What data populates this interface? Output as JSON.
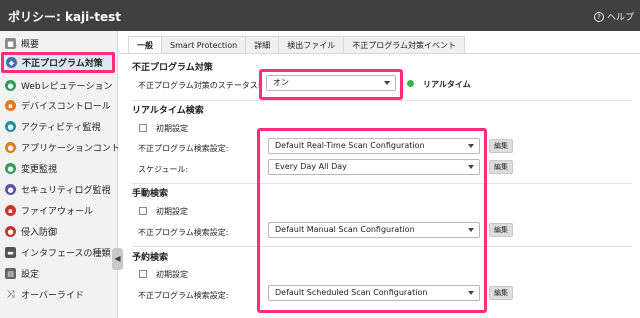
{
  "window": {
    "title": "ポリシー: kaji-test",
    "help_label": "ヘルプ"
  },
  "sidebar": {
    "items": [
      {
        "label": "概要",
        "icon": "overview-icon",
        "color": "#8a8a8a"
      },
      {
        "label": "不正プログラム対策",
        "icon": "shield-icon",
        "color": "#3f6fb6",
        "active": true
      },
      {
        "label": "Webレピュテーション",
        "icon": "globe-icon",
        "color": "#2f9e5a"
      },
      {
        "label": "デバイスコントロール",
        "icon": "device-icon",
        "color": "#e07a1f"
      },
      {
        "label": "アクティビティ監視",
        "icon": "activity-icon",
        "color": "#1f8fa8"
      },
      {
        "label": "アプリケーションコント",
        "icon": "app-control-icon",
        "color": "#e07a1f"
      },
      {
        "label": "変更監視",
        "icon": "integrity-icon",
        "color": "#2f9e5a"
      },
      {
        "label": "セキュリティログ監視",
        "icon": "log-inspection-icon",
        "color": "#5a4fb0"
      },
      {
        "label": "ファイアウォール",
        "icon": "firewall-icon",
        "color": "#c0392b"
      },
      {
        "label": "侵入防御",
        "icon": "intrusion-icon",
        "color": "#c0392b"
      },
      {
        "label": "インタフェースの種類",
        "icon": "interface-icon",
        "color": "#555555"
      },
      {
        "label": "設定",
        "icon": "settings-icon",
        "color": "#666666"
      },
      {
        "label": "オーバーライド",
        "icon": "override-icon",
        "color": "#444444"
      }
    ]
  },
  "tabs": [
    "一般",
    "Smart Protection",
    "詳細",
    "検出ファイル",
    "不正プログラム対策イベント"
  ],
  "general": {
    "heading": "不正プログラム対策",
    "status_label": "不正プログラム対策のステータス:",
    "status_value": "オン",
    "status_mode": "リアルタイム"
  },
  "realtime": {
    "heading": "リアルタイム検索",
    "inherit_label": "初期設定",
    "config_label": "不正プログラム検索設定:",
    "config_value": "Default Real-Time Scan Configuration",
    "schedule_label": "スケジュール:",
    "schedule_value": "Every Day All Day"
  },
  "manual": {
    "heading": "手動検索",
    "inherit_label": "初期設定",
    "config_label": "不正プログラム検索設定:",
    "config_value": "Default Manual Scan Configuration"
  },
  "scheduled": {
    "heading": "予約検索",
    "inherit_label": "初期設定",
    "config_label": "不正プログラム検索設定:",
    "config_value": "Default Scheduled Scan Configuration"
  },
  "edit_label": "編集",
  "colors": {
    "highlight": "#ff2d7a",
    "status_on": "#3bb24a",
    "titlebar": "#404040"
  }
}
